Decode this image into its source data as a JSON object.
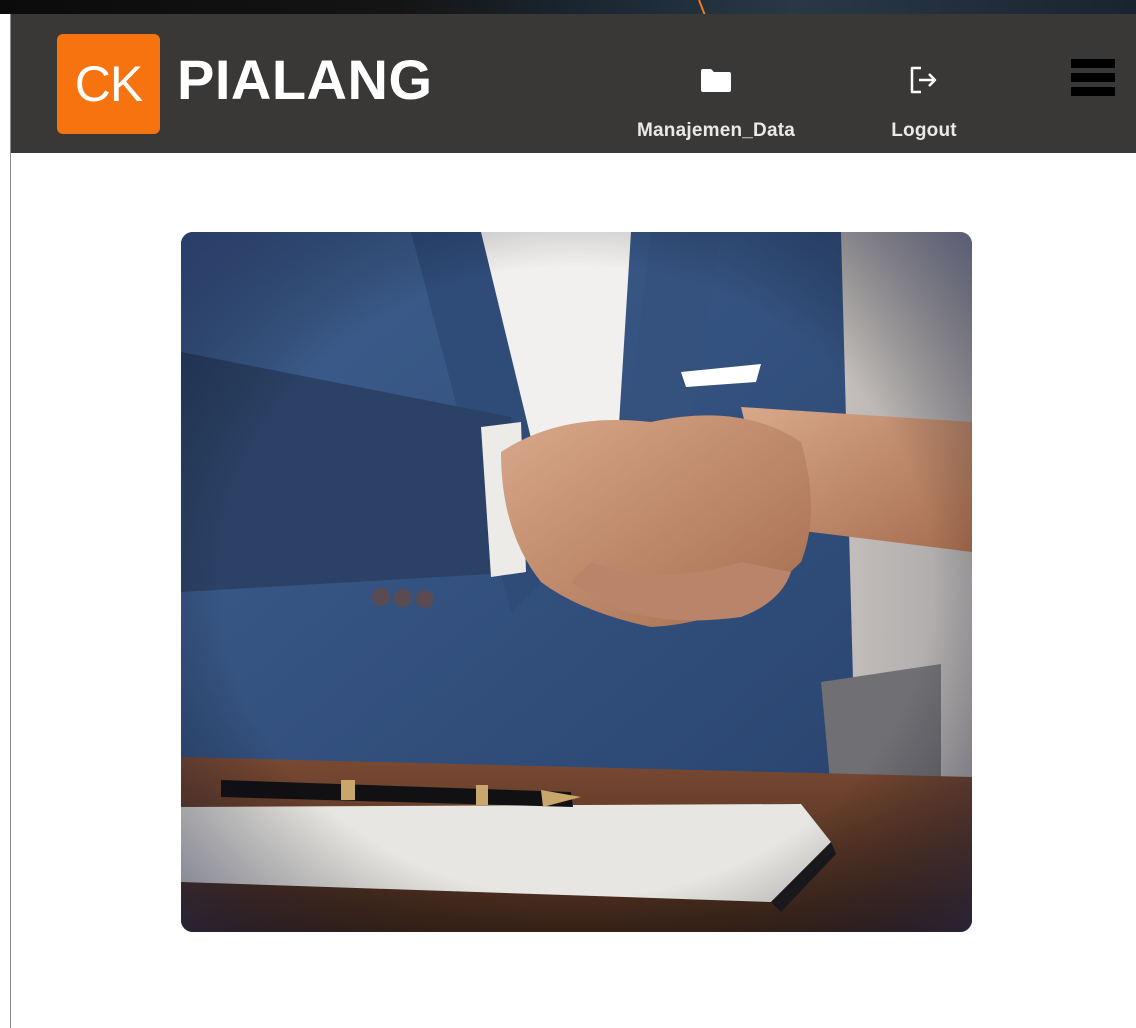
{
  "brand": {
    "logo_text": "CK",
    "name": "PIALANG",
    "accent_color": "#f7730f",
    "header_color": "#3a3836"
  },
  "nav": {
    "items": [
      {
        "label": "Manajemen_Data",
        "icon": "folder-icon"
      },
      {
        "label": "Logout",
        "icon": "logout-icon"
      }
    ],
    "menu_icon": "hamburger-menu-icon"
  },
  "hero": {
    "image": "business-handshake-photo"
  }
}
